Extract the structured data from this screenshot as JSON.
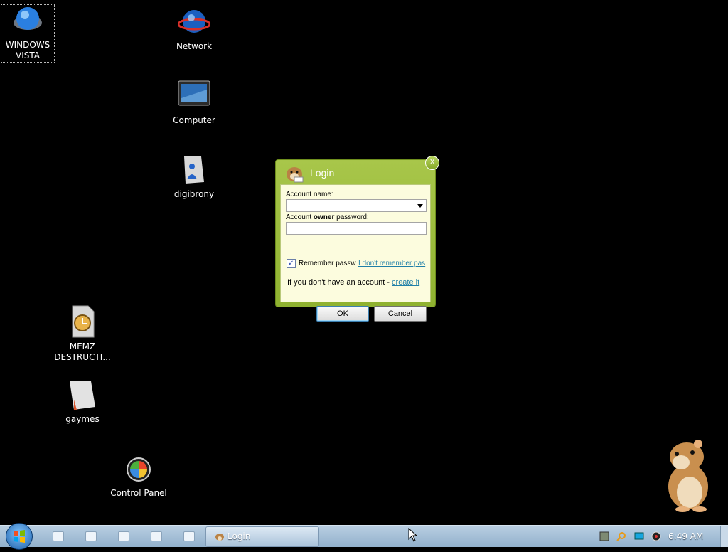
{
  "desktop": {
    "icons": [
      {
        "id": "windows-vista",
        "label": "WINDOWS VISTA"
      },
      {
        "id": "network",
        "label": "Network"
      },
      {
        "id": "computer",
        "label": "Computer"
      },
      {
        "id": "digibrony",
        "label": "digibrony"
      },
      {
        "id": "memz",
        "label": "MEMZ DESTRUCTI..."
      },
      {
        "id": "gaymes",
        "label": "gaymes"
      },
      {
        "id": "control-panel",
        "label": "Control Panel"
      }
    ]
  },
  "login_dialog": {
    "title": "Login",
    "close": "X",
    "account_name_label": "Account name:",
    "account_owner_password_prefix": "Account ",
    "account_owner_password_bold": "owner",
    "account_owner_password_suffix": " password:",
    "remember_label": "Remember passw",
    "forgot_link": "I don't remember pas",
    "no_account_text": "If you don't have an account - ",
    "create_link": "create it",
    "ok_label": "OK",
    "cancel_label": "Cancel",
    "remember_checked": "✓"
  },
  "taskbar": {
    "task_label": "Login",
    "clock": "6:49 AM"
  }
}
